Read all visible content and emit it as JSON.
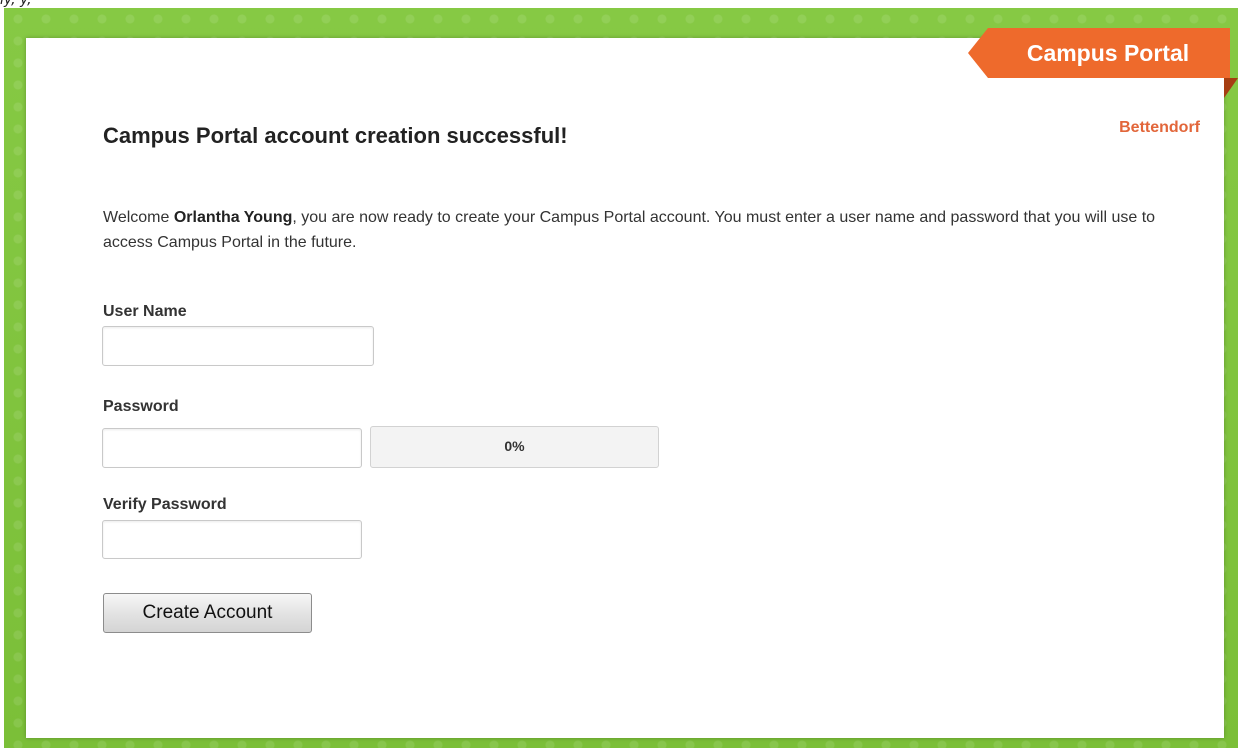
{
  "header": {
    "brand_label": "Campus Portal",
    "district_link": "Bettendorf"
  },
  "main": {
    "title": "Campus Portal account creation successful!",
    "intro_prefix": "Welcome ",
    "user_full_name": "Orlantha Young",
    "intro_suffix": ", you are now ready to create your Campus Portal account. You must enter a user name and password that you will use to access Campus Portal in the future."
  },
  "form": {
    "username_label": "User Name",
    "username_value": "",
    "password_label": "Password",
    "password_value": "",
    "password_strength_text": "0%",
    "password_strength_fraction": 0,
    "verify_password_label": "Verify Password",
    "verify_password_value": "",
    "submit_label": "Create Account"
  },
  "colors": {
    "frame_green": "#7cc23a",
    "ribbon_orange": "#ee6a2c",
    "district_orange": "#e2663a"
  }
}
